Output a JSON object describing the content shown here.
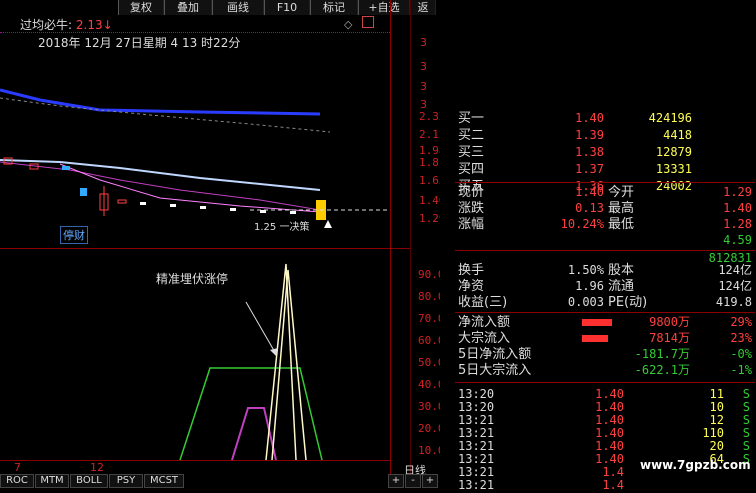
{
  "toolbar": {
    "buttons": [
      "复权",
      "叠加",
      "画线",
      "F10",
      "标记",
      "+自选",
      "返"
    ]
  },
  "header": {
    "indicator_name": "过均必牛:",
    "indicator_value": "2.13↓",
    "date_text": "2018年 12月 27日星期 4   13 时22分"
  },
  "kline": {
    "right_ticks": [
      "3",
      "3",
      "3",
      "3"
    ],
    "left_label": "停财",
    "price_axis": [
      "2.32",
      "2.12",
      "1.98",
      "1.81",
      "1.63",
      "1.46",
      "1.29"
    ],
    "bottom_label": "1.25 一决策"
  },
  "indicator": {
    "annotation": "精准埋伏涨停",
    "axis": [
      "90.00",
      "80.00",
      "70.00",
      "60.00",
      "50.00",
      "40.00",
      "30.00",
      "20.00",
      "10.00"
    ],
    "x_labels": [
      "7",
      "12"
    ],
    "period": "日线"
  },
  "quote": {
    "levels": [
      {
        "label": "买一",
        "price": "1.40",
        "vol": "424196"
      },
      {
        "label": "买二",
        "price": "1.39",
        "vol": "4418"
      },
      {
        "label": "买三",
        "price": "1.38",
        "vol": "12879"
      },
      {
        "label": "买四",
        "price": "1.37",
        "vol": "13331"
      },
      {
        "label": "买五",
        "price": "1.36",
        "vol": "24002"
      }
    ],
    "stats": [
      {
        "l1": "现价",
        "v1": "1.40",
        "l2": "今开",
        "v2": "1.29"
      },
      {
        "l1": "涨跌",
        "v1": "0.13",
        "l2": "最高",
        "v2": "1.40"
      },
      {
        "l1": "涨幅",
        "v1": "10.24%",
        "l2": "最低",
        "v2": "1.28"
      }
    ],
    "extra1": "4.59",
    "extra2": "812831",
    "info": [
      {
        "l1": "换手",
        "v1": "1.50%",
        "l2": "股本",
        "v2": "124亿"
      },
      {
        "l1": "净资",
        "v1": "1.96",
        "l2": "流通",
        "v2": "124亿"
      },
      {
        "l1": "收益(三)",
        "v1": "0.003",
        "l2": "PE(动)",
        "v2": "419.8"
      }
    ],
    "flows": [
      {
        "label": "净流入额",
        "amount": "9800万",
        "pct": "29%"
      },
      {
        "label": "大宗流入",
        "amount": "7814万",
        "pct": "23%"
      },
      {
        "label": "5日净流入额",
        "amount": "-181.7万",
        "pct": "-0%"
      },
      {
        "label": "5日大宗流入",
        "amount": "-622.1万",
        "pct": "-1%"
      }
    ],
    "trades": [
      {
        "time": "13:20",
        "price": "1.40",
        "vol": "11",
        "side": "S"
      },
      {
        "time": "13:20",
        "price": "1.40",
        "vol": "10",
        "side": "S"
      },
      {
        "time": "13:21",
        "price": "1.40",
        "vol": "12",
        "side": "S"
      },
      {
        "time": "13:21",
        "price": "1.40",
        "vol": "110",
        "side": "S"
      },
      {
        "time": "13:21",
        "price": "1.40",
        "vol": "20",
        "side": "S"
      },
      {
        "time": "13:21",
        "price": "1.40",
        "vol": "64",
        "side": "S"
      },
      {
        "time": "13:21",
        "price": "1.4",
        "vol": "",
        "side": ""
      },
      {
        "time": "13:21",
        "price": "1.4",
        "vol": "",
        "side": ""
      }
    ],
    "watermark": "www.7gpzb.com"
  },
  "bottom_tabs": [
    "ROC",
    "MTM",
    "BOLL",
    "PSY",
    "MCST",
    "+",
    "-",
    "+"
  ],
  "colors": {
    "up": "#ff4040",
    "down": "#33cc33",
    "volume": "#ffff55",
    "accent": "#00aaff"
  }
}
